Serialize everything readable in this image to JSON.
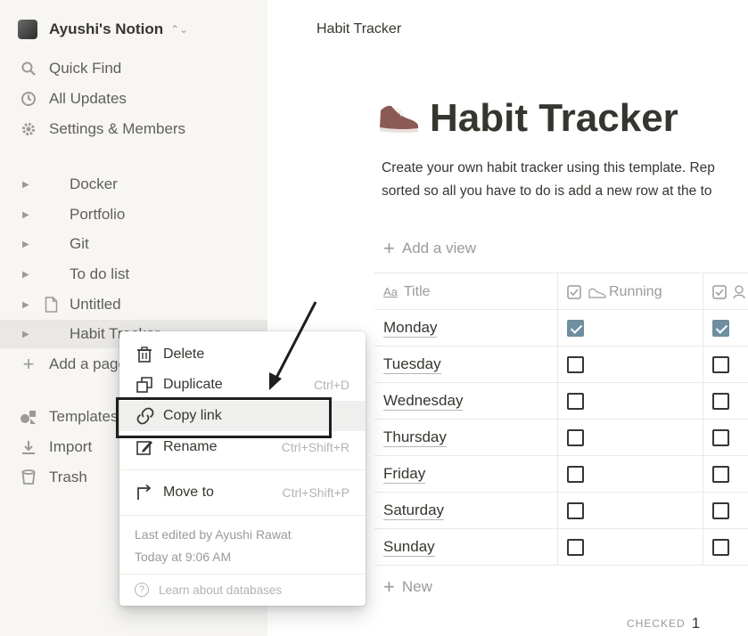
{
  "sidebar": {
    "workspace": "Ayushi's Notion",
    "nav": [
      {
        "label": "Quick Find",
        "icon": "search-icon"
      },
      {
        "label": "All Updates",
        "icon": "clock-icon"
      },
      {
        "label": "Settings & Members",
        "icon": "gear-icon"
      }
    ],
    "pages": [
      {
        "label": "Docker"
      },
      {
        "label": "Portfolio"
      },
      {
        "label": "Git"
      },
      {
        "label": "To do list"
      },
      {
        "label": "Untitled"
      },
      {
        "label": "Habit Tracker"
      }
    ],
    "add_page": "Add a page",
    "footer": [
      {
        "label": "Templates",
        "icon": "templates-icon"
      },
      {
        "label": "Import",
        "icon": "import-icon"
      },
      {
        "label": "Trash",
        "icon": "trash-icon"
      }
    ]
  },
  "topbar": {
    "title": "Habit Tracker"
  },
  "page": {
    "title": "Habit Tracker",
    "description_line1": "Create your own habit tracker using this template. Rep",
    "description_line2": "sorted so all you have to do is add a new row at the to",
    "add_view": "Add a view"
  },
  "table": {
    "columns": [
      {
        "label": "Title"
      },
      {
        "label": "Running"
      }
    ],
    "rows": [
      {
        "day": "Monday",
        "running": true,
        "third": true
      },
      {
        "day": "Tuesday",
        "running": false,
        "third": false
      },
      {
        "day": "Wednesday",
        "running": false,
        "third": false
      },
      {
        "day": "Thursday",
        "running": false,
        "third": false
      },
      {
        "day": "Friday",
        "running": false,
        "third": false
      },
      {
        "day": "Saturday",
        "running": false,
        "third": false
      },
      {
        "day": "Sunday",
        "running": false,
        "third": false
      }
    ],
    "new_label": "New",
    "checked_label": "CHECKED",
    "checked_count": "1"
  },
  "menu": {
    "items": [
      {
        "label": "Delete",
        "shortcut": "",
        "icon": "trash-icon"
      },
      {
        "label": "Duplicate",
        "shortcut": "Ctrl+D",
        "icon": "duplicate-icon"
      },
      {
        "label": "Copy link",
        "shortcut": "",
        "icon": "link-icon"
      },
      {
        "label": "Rename",
        "shortcut": "Ctrl+Shift+R",
        "icon": "rename-icon"
      },
      {
        "label": "Move to",
        "shortcut": "Ctrl+Shift+P",
        "icon": "move-to-icon"
      }
    ],
    "last_edited_by": "Last edited by Ayushi Rawat",
    "last_edited_time": "Today at 9:06 AM",
    "learn": "Learn about databases"
  },
  "colors": {
    "checkbox_checked": "#6f8fa1",
    "sidebar_bg": "#f7f6f3",
    "menu_highlight": "#efefee"
  }
}
